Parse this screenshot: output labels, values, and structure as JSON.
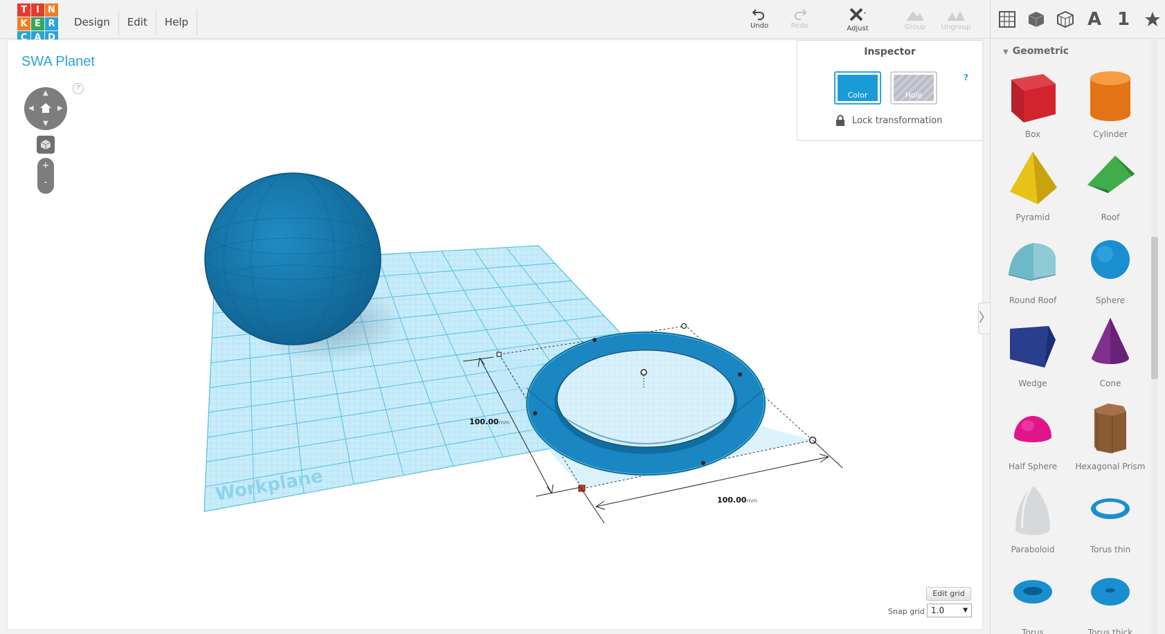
{
  "logo": {
    "letters": [
      "T",
      "I",
      "N",
      "K",
      "E",
      "R",
      "C",
      "A",
      "D"
    ],
    "colors": [
      "#e73a2f",
      "#e73a2f",
      "#f47c20",
      "#f47c20",
      "#34a853",
      "#2ba3d6",
      "#2ba3d6",
      "#2ba3d6",
      "#2ba3d6"
    ]
  },
  "menu": [
    "Design",
    "Edit",
    "Help"
  ],
  "toolbar": {
    "undo": "Undo",
    "redo": "Redo",
    "adjust": "Adjust",
    "group": "Group",
    "ungroup": "Ungroup"
  },
  "view_tools": {
    "number": "1",
    "letter": "A"
  },
  "design": {
    "title": "SWA Planet"
  },
  "nav": {
    "help": "?",
    "zoom_in": "+",
    "zoom_out": "-"
  },
  "inspector": {
    "title": "Inspector",
    "color_label": "Color",
    "hole_label": "Hole",
    "help": "?",
    "lock_label": "Lock transformation",
    "color": "#1a9bd7"
  },
  "scene": {
    "workplane_label": "Workplane",
    "dim_width": "100.00",
    "dim_depth": "100.00",
    "dim_unit": "mm"
  },
  "panel": {
    "heading": "Geometric",
    "shapes": [
      "Box",
      "Cylinder",
      "Pyramid",
      "Roof",
      "Round Roof",
      "Sphere",
      "Wedge",
      "Cone",
      "Half Sphere",
      "Hexagonal Prism",
      "Paraboloid",
      "Torus thin",
      "Torus",
      "Torus thick"
    ]
  },
  "grid": {
    "edit_label": "Edit grid",
    "snap_label": "Snap grid",
    "snap_value": "1.0"
  },
  "colors": {
    "accent": "#2ba3d6",
    "shape_blue": "#1778ad",
    "workplane": "#aee3f7"
  }
}
